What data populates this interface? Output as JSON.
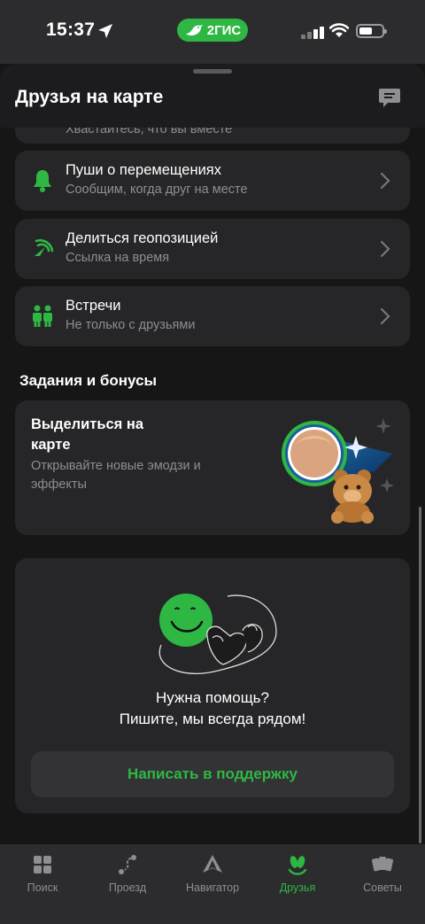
{
  "status": {
    "time": "15:37",
    "app_badge": "2ГИС"
  },
  "header": {
    "title": "Друзья на карте"
  },
  "partial_row": {
    "subtitle": "Хвастайтесь, что вы вместе"
  },
  "rows": [
    {
      "title": "Пуши о перемещениях",
      "subtitle": "Сообщим, когда друг на месте"
    },
    {
      "title": "Делиться геопозицией",
      "subtitle": "Ссылка на время"
    },
    {
      "title": "Встречи",
      "subtitle": "Не только с друзьями"
    }
  ],
  "tasks": {
    "section_title": "Задания и бонусы",
    "promo_title": "Выделиться на карте",
    "promo_subtitle": "Открывайте новые эмодзи и эффекты"
  },
  "help": {
    "line1": "Нужна помощь?",
    "line2": "Пишите, мы всегда рядом!",
    "button": "Написать в поддержку"
  },
  "tabs": [
    {
      "label": "Поиск",
      "icon": "grid-icon"
    },
    {
      "label": "Проезд",
      "icon": "route-icon"
    },
    {
      "label": "Навигатор",
      "icon": "navigator-icon"
    },
    {
      "label": "Друзья",
      "icon": "friends-icon",
      "active": true
    },
    {
      "label": "Советы",
      "icon": "cards-icon"
    }
  ],
  "colors": {
    "accent": "#2fb744",
    "background": "#161616",
    "card": "#262628"
  }
}
